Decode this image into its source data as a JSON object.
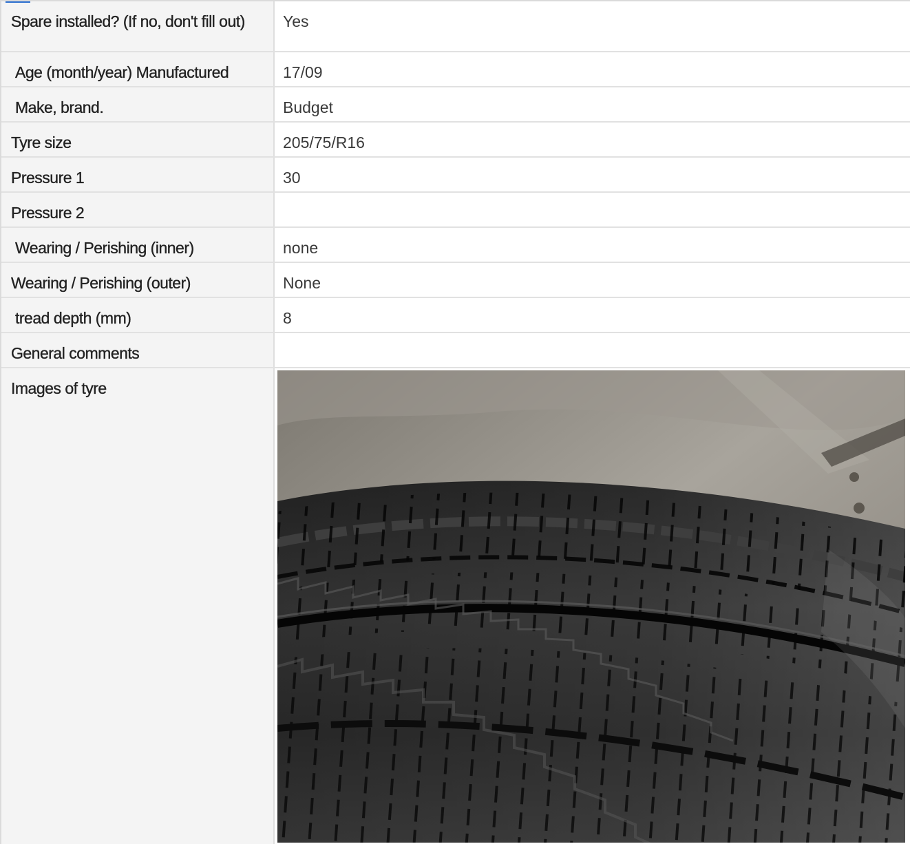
{
  "rows": [
    {
      "label": "Spare installed? (If no, don't fill out)",
      "value": "Yes"
    },
    {
      "label": "Age (month/year) Manufactured",
      "value": "17/09"
    },
    {
      "label": "Make, brand.",
      "value": "Budget"
    },
    {
      "label": "Tyre size",
      "value": "205/75/R16"
    },
    {
      "label": "Pressure 1",
      "value": "30"
    },
    {
      "label": "Pressure 2",
      "value": ""
    },
    {
      "label": "Wearing / Perishing (inner)",
      "value": "none"
    },
    {
      "label": "Wearing / Perishing (outer)",
      "value": "None"
    },
    {
      "label": "tread depth (mm)",
      "value": "8"
    },
    {
      "label": "General comments",
      "value": ""
    }
  ],
  "images_row": {
    "label": "Images of tyre",
    "photo_icon": "tyre-tread-photo"
  },
  "colors": {
    "label_bg": "#f4f4f4",
    "value_bg": "#ffffff",
    "border": "#e1e1e1",
    "label_text": "#222222",
    "value_text": "#3a3a3a"
  }
}
